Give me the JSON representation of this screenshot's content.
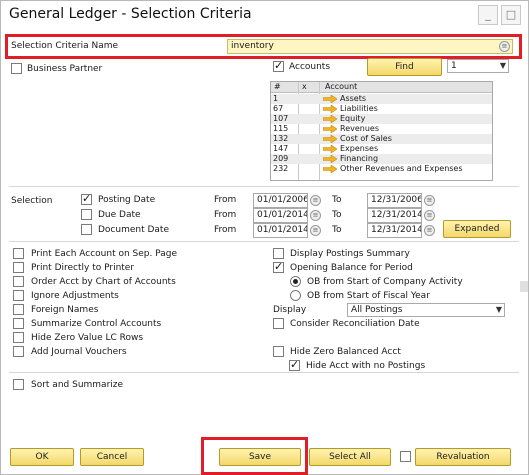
{
  "window": {
    "title": "General Ledger - Selection Criteria",
    "minimize": "_",
    "maximize": "□"
  },
  "criteria": {
    "label": "Selection Criteria Name",
    "value": "inventory"
  },
  "business_partner": {
    "label": "Business Partner",
    "checked": false
  },
  "accounts": {
    "label": "Accounts",
    "checked": true,
    "find_label": "Find",
    "find_select": "1"
  },
  "grid": {
    "headers": [
      "#",
      "x",
      "Account"
    ],
    "rows": [
      {
        "num": "1",
        "name": "Assets"
      },
      {
        "num": "67",
        "name": "Liabilities"
      },
      {
        "num": "107",
        "name": "Equity"
      },
      {
        "num": "115",
        "name": "Revenues"
      },
      {
        "num": "132",
        "name": "Cost of Sales"
      },
      {
        "num": "147",
        "name": "Expenses"
      },
      {
        "num": "209",
        "name": "Financing"
      },
      {
        "num": "232",
        "name": "Other Revenues and Expenses"
      }
    ]
  },
  "selection": {
    "label": "Selection",
    "from_label": "From",
    "to_label": "To",
    "rows": [
      {
        "label": "Posting Date",
        "checked": true,
        "from": "01/01/2006",
        "to": "12/31/2006"
      },
      {
        "label": "Due Date",
        "checked": false,
        "from": "01/01/2014",
        "to": "12/31/2014"
      },
      {
        "label": "Document Date",
        "checked": false,
        "from": "01/01/2014",
        "to": "12/31/2014"
      }
    ],
    "expanded_label": "Expanded"
  },
  "left_options": [
    {
      "label": "Print Each Account on Sep. Page",
      "checked": false
    },
    {
      "label": "Print Directly to Printer",
      "checked": false
    },
    {
      "label": "Order Acct by Chart of Accounts",
      "checked": false
    },
    {
      "label": "Ignore Adjustments",
      "checked": false
    },
    {
      "label": "Foreign Names",
      "checked": false
    },
    {
      "label": "Summarize Control Accounts",
      "checked": false
    },
    {
      "label": "Hide Zero Value LC Rows",
      "checked": false
    },
    {
      "label": "Add Journal Vouchers",
      "checked": false
    }
  ],
  "right_options": {
    "display_postings_summary": {
      "label": "Display Postings Summary",
      "checked": false
    },
    "opening_balance": {
      "label": "Opening Balance for Period",
      "checked": true
    },
    "ob_company": {
      "label": "OB from Start of Company Activity",
      "checked": true
    },
    "ob_fiscal": {
      "label": "OB from Start of Fiscal Year",
      "checked": false
    },
    "display_label": "Display",
    "display_value": "All Postings",
    "consider_reconciliation": {
      "label": "Consider Reconciliation Date",
      "checked": false
    },
    "hide_zero_balanced": {
      "label": "Hide Zero Balanced Acct",
      "checked": false
    },
    "hide_no_postings": {
      "label": "Hide Acct with no Postings",
      "checked": true
    }
  },
  "sort_and_summarize": {
    "label": "Sort and Summarize",
    "checked": false
  },
  "buttons": {
    "ok": "OK",
    "cancel": "Cancel",
    "save": "Save",
    "select_all": "Select All",
    "revaluation": "Revaluation",
    "revaluation_checked": false
  },
  "colors": {
    "highlight": "#e01e27",
    "button_gold": "#f3d86a",
    "field_yellow": "#fdf6c2",
    "arrow_gold": "#f0b428"
  }
}
